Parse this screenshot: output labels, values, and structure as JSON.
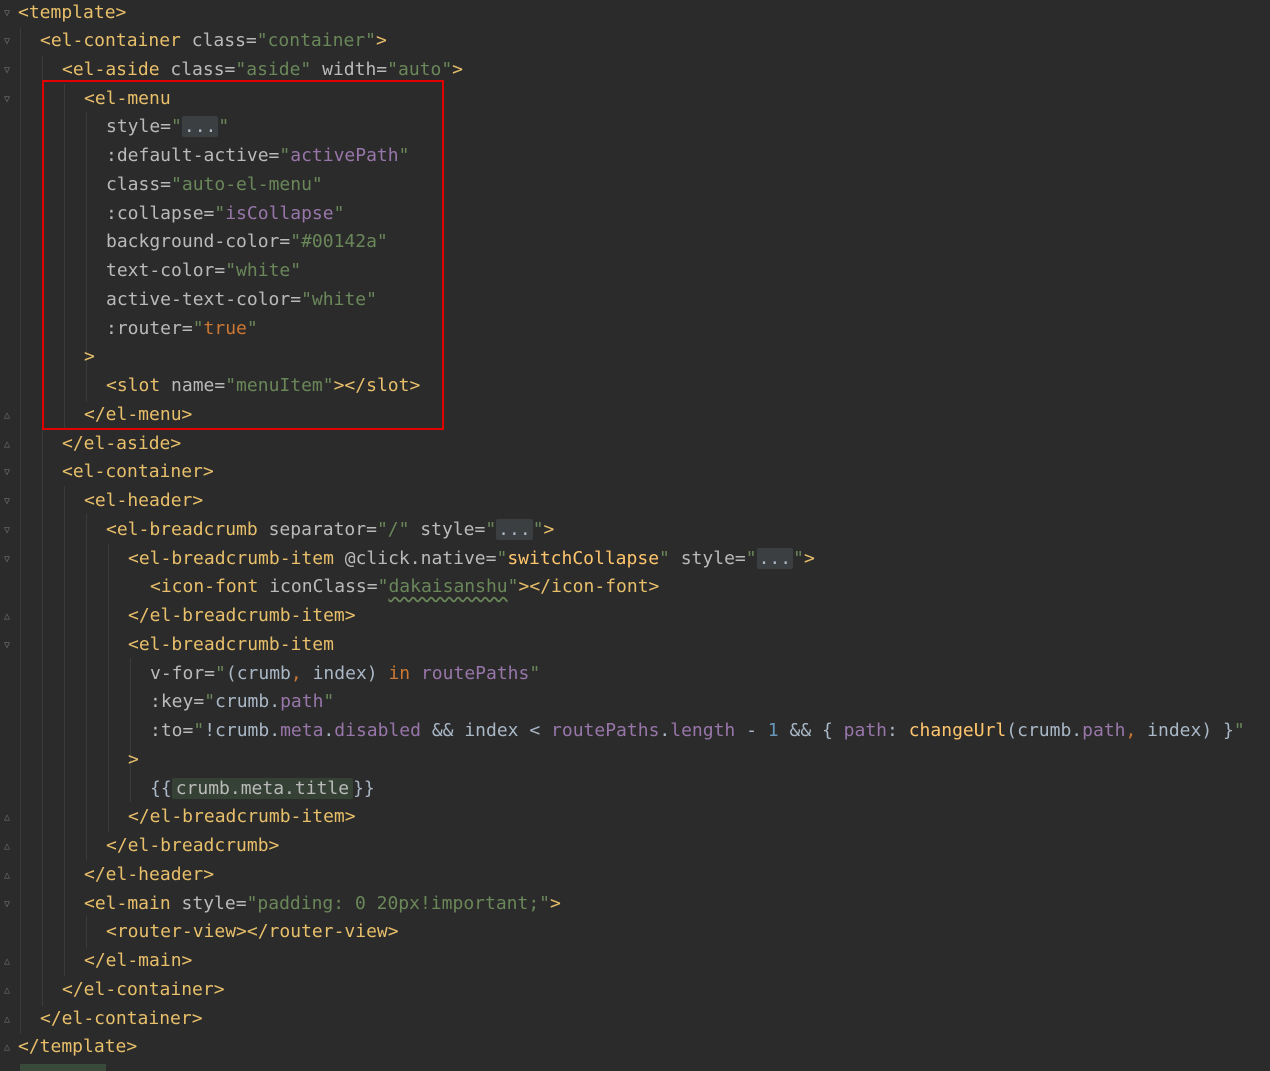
{
  "editor": {
    "lines": [
      {
        "parts": [
          [
            "t",
            "<template>"
          ]
        ]
      },
      {
        "parts": [
          [
            "t",
            "<el-container "
          ],
          [
            "a",
            "class="
          ],
          [
            "s",
            "\"container\""
          ],
          [
            "t",
            ">"
          ]
        ]
      },
      {
        "parts": [
          [
            "t",
            "<el-aside "
          ],
          [
            "a",
            "class="
          ],
          [
            "s",
            "\"aside\" "
          ],
          [
            "a",
            "width="
          ],
          [
            "s",
            "\"auto\""
          ],
          [
            "t",
            ">"
          ]
        ]
      },
      {
        "parts": [
          [
            "t",
            "<el-menu"
          ]
        ]
      },
      {
        "parts": [
          [
            "a",
            "style="
          ],
          [
            "s",
            "\""
          ],
          [
            "fold-ph",
            "..."
          ],
          [
            "s",
            "\""
          ]
        ]
      },
      {
        "parts": [
          [
            "a",
            ":default-active="
          ],
          [
            "s",
            "\""
          ],
          [
            "p",
            "activePath"
          ],
          [
            "s",
            "\""
          ]
        ]
      },
      {
        "parts": [
          [
            "a",
            "class="
          ],
          [
            "s",
            "\"auto-el-menu\""
          ]
        ]
      },
      {
        "parts": [
          [
            "a",
            ":collapse="
          ],
          [
            "s",
            "\""
          ],
          [
            "p",
            "isCollapse"
          ],
          [
            "s",
            "\""
          ]
        ]
      },
      {
        "parts": [
          [
            "a",
            "background-color="
          ],
          [
            "s",
            "\"#00142a\""
          ]
        ]
      },
      {
        "parts": [
          [
            "a",
            "text-color="
          ],
          [
            "s",
            "\"white\""
          ]
        ]
      },
      {
        "parts": [
          [
            "a",
            "active-text-color="
          ],
          [
            "s",
            "\"white\""
          ]
        ]
      },
      {
        "parts": [
          [
            "a",
            ":router="
          ],
          [
            "s",
            "\""
          ],
          [
            "k",
            "true"
          ],
          [
            "s",
            "\""
          ]
        ]
      },
      {
        "parts": [
          [
            "t",
            ">"
          ]
        ]
      },
      {
        "parts": [
          [
            "t",
            "<slot "
          ],
          [
            "a",
            "name="
          ],
          [
            "s",
            "\"menuItem\""
          ],
          [
            "t",
            "></slot>"
          ]
        ]
      },
      {
        "parts": [
          [
            "t",
            "</el-menu>"
          ]
        ]
      },
      {
        "parts": [
          [
            "t",
            "</el-aside>"
          ]
        ]
      },
      {
        "parts": [
          [
            "t",
            "<el-container>"
          ]
        ]
      },
      {
        "parts": [
          [
            "t",
            "<el-header>"
          ]
        ]
      },
      {
        "parts": [
          [
            "t",
            "<el-breadcrumb "
          ],
          [
            "a",
            "separator="
          ],
          [
            "s",
            "\"/\" "
          ],
          [
            "a",
            "style="
          ],
          [
            "s",
            "\""
          ],
          [
            "fold-ph",
            "..."
          ],
          [
            "s",
            "\""
          ],
          [
            "t",
            ">"
          ]
        ]
      },
      {
        "parts": [
          [
            "t",
            "<el-breadcrumb-item "
          ],
          [
            "a",
            "@click.native="
          ],
          [
            "s",
            "\""
          ],
          [
            "fn",
            "switchCollapse"
          ],
          [
            "s",
            "\" "
          ],
          [
            "a",
            "style="
          ],
          [
            "s",
            "\""
          ],
          [
            "fold-ph",
            "..."
          ],
          [
            "s",
            "\""
          ],
          [
            "t",
            ">"
          ]
        ]
      },
      {
        "parts": [
          [
            "t",
            "<icon-font "
          ],
          [
            "a",
            "iconClass="
          ],
          [
            "s",
            "\""
          ],
          [
            "wavy",
            "dakaisanshu"
          ],
          [
            "s",
            "\""
          ],
          [
            "t",
            "></icon-font>"
          ]
        ]
      },
      {
        "parts": [
          [
            "t",
            "</el-breadcrumb-item>"
          ]
        ]
      },
      {
        "parts": [
          [
            "t",
            "<el-breadcrumb-item"
          ]
        ]
      },
      {
        "parts": [
          [
            "a",
            "v-for="
          ],
          [
            "s",
            "\""
          ],
          [
            "plain",
            "(crumb"
          ],
          [
            "k",
            ", "
          ],
          [
            "plain",
            "index) "
          ],
          [
            "k",
            "in "
          ],
          [
            "p",
            "routePaths"
          ],
          [
            "s",
            "\""
          ]
        ]
      },
      {
        "parts": [
          [
            "a",
            ":key="
          ],
          [
            "s",
            "\""
          ],
          [
            "plain",
            "crumb."
          ],
          [
            "p",
            "path"
          ],
          [
            "s",
            "\""
          ]
        ]
      },
      {
        "parts": [
          [
            "a",
            ":to="
          ],
          [
            "s",
            "\""
          ],
          [
            "plain",
            "!crumb."
          ],
          [
            "p",
            "meta"
          ],
          [
            "plain",
            "."
          ],
          [
            "p",
            "disabled "
          ],
          [
            "plain",
            "&& index < "
          ],
          [
            "p",
            "routePaths"
          ],
          [
            "plain",
            "."
          ],
          [
            "p",
            "length "
          ],
          [
            "plain",
            "- "
          ],
          [
            "n",
            "1 "
          ],
          [
            "plain",
            "&& { "
          ],
          [
            "p",
            "path"
          ],
          [
            "plain",
            ": "
          ],
          [
            "fn",
            "changeUrl"
          ],
          [
            "plain",
            "(crumb."
          ],
          [
            "p",
            "path"
          ],
          [
            "k",
            ", "
          ],
          [
            "plain",
            "index) }"
          ],
          [
            "s",
            "\""
          ]
        ]
      },
      {
        "parts": [
          [
            "t",
            ">"
          ]
        ]
      },
      {
        "parts": [
          [
            "plain",
            "{{"
          ],
          [
            "interp",
            "crumb.meta.title"
          ],
          [
            "plain",
            "}}"
          ]
        ]
      },
      {
        "parts": [
          [
            "t",
            "</el-breadcrumb-item>"
          ]
        ]
      },
      {
        "parts": [
          [
            "t",
            "</el-breadcrumb>"
          ]
        ]
      },
      {
        "parts": [
          [
            "t",
            "</el-header>"
          ]
        ]
      },
      {
        "parts": [
          [
            "t",
            "<el-main "
          ],
          [
            "a",
            "style="
          ],
          [
            "s",
            "\"padding: 0 20px!important;\""
          ],
          [
            "t",
            ">"
          ]
        ]
      },
      {
        "parts": [
          [
            "t",
            "<router-view></router-view>"
          ]
        ]
      },
      {
        "parts": [
          [
            "t",
            "</el-main>"
          ]
        ]
      },
      {
        "parts": [
          [
            "t",
            "</el-container>"
          ]
        ]
      },
      {
        "parts": [
          [
            "t",
            "</el-container>"
          ]
        ]
      },
      {
        "parts": [
          [
            "t",
            "</template>"
          ]
        ]
      }
    ]
  }
}
